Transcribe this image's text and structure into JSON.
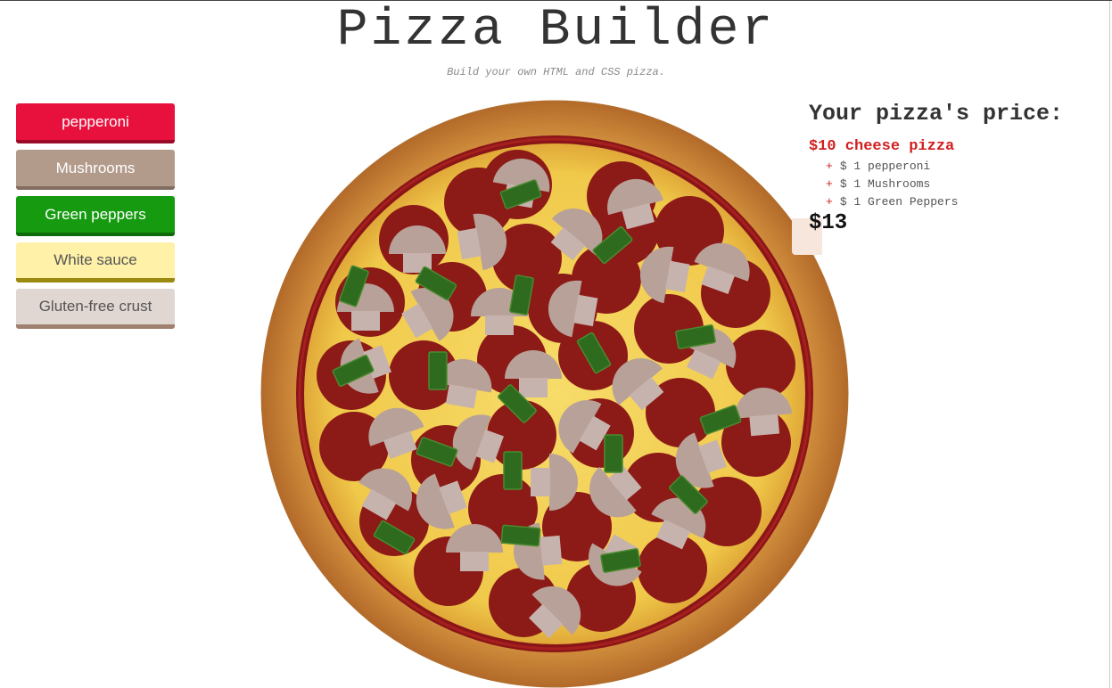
{
  "header": {
    "title": "Pizza Builder",
    "subtitle": "Build your own HTML and CSS pizza."
  },
  "controls": {
    "pepperoni": "pepperoni",
    "mushrooms": "Mushrooms",
    "green_peppers": "Green peppers",
    "white_sauce": "White sauce",
    "gluten_free_crust": "Gluten-free crust"
  },
  "price": {
    "heading": "Your pizza's price:",
    "base": "$10 cheese pizza",
    "items": [
      {
        "plus": "+",
        "label": "$ 1 pepperoni"
      },
      {
        "plus": "+",
        "label": "$ 1 Mushrooms"
      },
      {
        "plus": "+",
        "label": "$ 1 Green Peppers"
      }
    ],
    "total": "$13"
  },
  "colors": {
    "pepperoni": "#8c1a17",
    "mushroom": "#b8a198",
    "green_pepper": "#2e6b1e",
    "cheese": "#f2cc52",
    "crust": "#c27a35",
    "sauce": "#8a1518"
  }
}
